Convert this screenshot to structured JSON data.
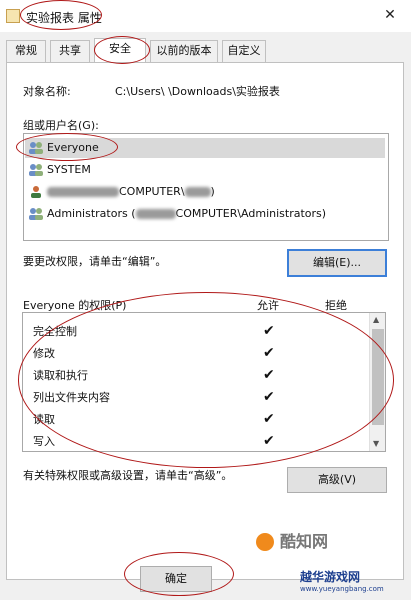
{
  "window": {
    "title": "实验报表 属性",
    "close_glyph": "✕"
  },
  "tabs": [
    {
      "label": "常规"
    },
    {
      "label": "共享"
    },
    {
      "label": "安全",
      "active": true
    },
    {
      "label": "以前的版本"
    },
    {
      "label": "自定义"
    }
  ],
  "security": {
    "object_name_label": "对象名称:",
    "object_name_value": "C:\\Users\\        \\Downloads\\实验报表",
    "group_label": "组或用户名(G):",
    "groups": [
      {
        "name": "Everyone",
        "selected": true
      },
      {
        "name": "SYSTEM"
      },
      {
        "name": "COMPUTER\\",
        "prefix_redacted": true,
        "suffix": ")"
      },
      {
        "name": "Administrators (",
        "mid_redacted": true,
        "suffix": "COMPUTER\\Administrators)"
      }
    ],
    "edit_hint": "要更改权限，请单击“编辑”。",
    "edit_button": "编辑(E)...",
    "perm_header": "Everyone 的权限(P)",
    "allow_header": "允许",
    "deny_header": "拒绝",
    "permissions": [
      {
        "name": "完全控制",
        "allow": "✔"
      },
      {
        "name": "修改",
        "allow": "✔"
      },
      {
        "name": "读取和执行",
        "allow": "✔"
      },
      {
        "name": "列出文件夹内容",
        "allow": "✔"
      },
      {
        "name": "读取",
        "allow": "✔"
      },
      {
        "name": "写入",
        "allow": "✔"
      }
    ],
    "advanced_hint": "有关特殊权限或高级设置，请单击“高级”。",
    "advanced_button": "高级(V)",
    "ok_button": "确定"
  },
  "watermarks": {
    "brand1": "酷知网",
    "brand2": "越华游戏网",
    "url": "www.yueyangbang.com"
  },
  "colors": {
    "annotation": "#b01818",
    "focus_border": "#3c7fd8",
    "selection": "#d9d9d9"
  }
}
